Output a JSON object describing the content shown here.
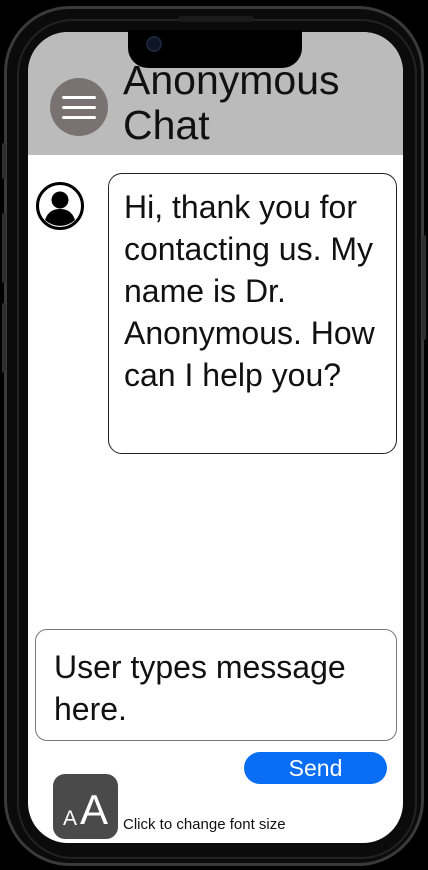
{
  "header": {
    "title": "Anonymous Chat",
    "menu_icon": "hamburger-menu-icon"
  },
  "chat": {
    "messages": [
      {
        "sender_icon": "user-avatar-icon",
        "text": "Hi, thank you for contacting us. My name is Dr. Anonymous. How can I help you?"
      }
    ]
  },
  "composer": {
    "placeholder": "User types message here.",
    "send_label": "Send"
  },
  "font_size": {
    "small_glyph": "A",
    "large_glyph": "A",
    "hint": "Click to change font size"
  },
  "colors": {
    "header_bg": "#bbbbbb",
    "menu_button_bg": "#7a7272",
    "send_button": "#0a6ef5",
    "font_button_bg": "#4a4a4a"
  }
}
